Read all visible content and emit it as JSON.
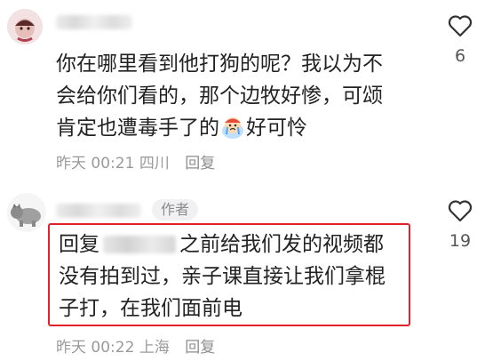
{
  "comments": [
    {
      "text_line1": "你在哪里看到他打狗的呢？我以为不",
      "text_line2": "会给你们看的，那个边牧好惨，可颂",
      "text_line3a": "肯定也遭毒手了的",
      "text_line3b": "好可怜",
      "emoji": "crying-face-emoji",
      "time": "昨天 00:21",
      "location": "四川",
      "reply_label": "回复",
      "likes": "6"
    },
    {
      "badge": "作者",
      "reply_prefix": "回复",
      "text_part1": "之前给我们发的视频都",
      "text_line2": "没有拍到过，亲子课直接让我们拿棍",
      "text_line3": "子打，在我们面前电",
      "time": "昨天 00:22",
      "location": "上海",
      "reply_label": "回复",
      "likes": "19"
    }
  ],
  "colors": {
    "highlight_border": "#e0212c",
    "meta_text": "#9a9a9a"
  }
}
